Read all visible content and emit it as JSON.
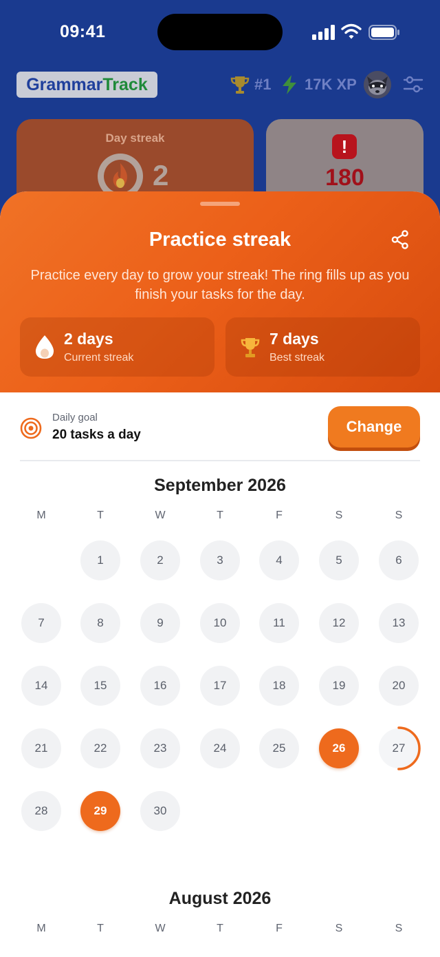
{
  "status_bar": {
    "time": "09:41"
  },
  "app": {
    "logo_part1": "Grammar",
    "logo_part2": "Track",
    "rank": "#1",
    "xp": "17K XP"
  },
  "back_cards": {
    "streak_label": "Day streak",
    "streak_value": "2",
    "errors_value": "180"
  },
  "sheet": {
    "title": "Practice streak",
    "description": "Practice every day to grow your streak! The ring fills up as you finish your tasks for the day.",
    "current": {
      "value": "2 days",
      "label": "Current streak"
    },
    "best": {
      "value": "7 days",
      "label": "Best streak"
    }
  },
  "goal": {
    "label": "Daily goal",
    "value": "20 tasks a day",
    "button": "Change"
  },
  "colors": {
    "accent": "#EE6A1D",
    "header_blue": "#1A3A8F"
  },
  "weekdays": [
    "M",
    "T",
    "W",
    "T",
    "F",
    "S",
    "S"
  ],
  "calendar": {
    "september": {
      "title": "September 2026",
      "days": [
        "1",
        "2",
        "3",
        "4",
        "5",
        "6",
        "7",
        "8",
        "9",
        "10",
        "11",
        "12",
        "13",
        "14",
        "15",
        "16",
        "17",
        "18",
        "19",
        "20",
        "21",
        "22",
        "23",
        "24",
        "25",
        "26",
        "27",
        "28",
        "29",
        "30"
      ],
      "completed": [
        "26",
        "29"
      ],
      "today": "27",
      "today_progress": 0.5
    },
    "august": {
      "title": "August 2026"
    }
  }
}
